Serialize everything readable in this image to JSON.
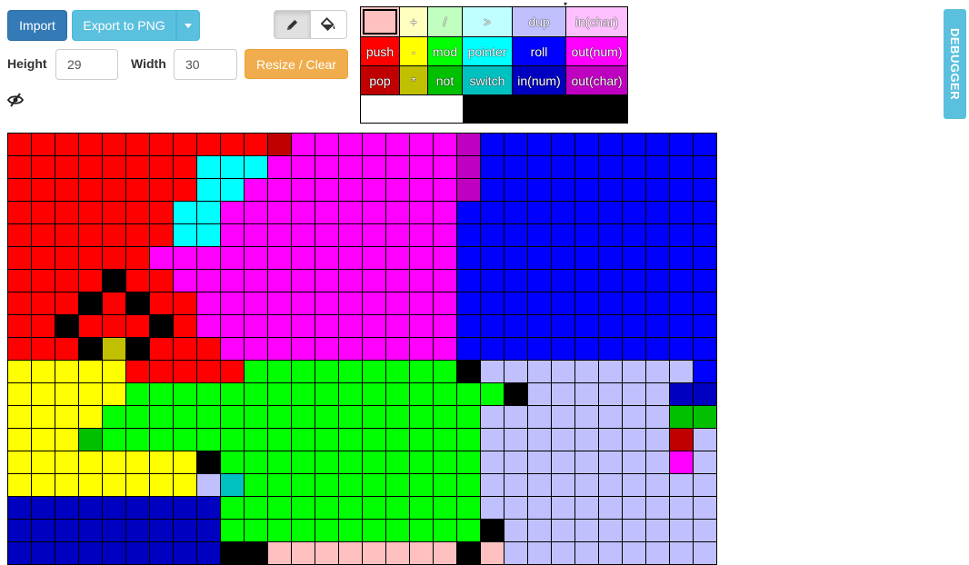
{
  "toolbar": {
    "import_label": "Import",
    "export_label": "Export to PNG",
    "caret_icon": "caret-down-icon",
    "pencil_icon": "pencil-icon",
    "bucket_icon": "paint-bucket-icon"
  },
  "size": {
    "height_label": "Height",
    "height_value": "29",
    "width_label": "Width",
    "width_value": "30",
    "resize_label": "Resize / Clear"
  },
  "visibility_icon": "eye-slash-icon",
  "debugger_label": "DEBUGGER",
  "palette": {
    "selected": "#ffc0c0",
    "rows": [
      [
        {
          "label": "",
          "color": "#ffc0c0"
        },
        {
          "label": "+",
          "color": "#ffffc0"
        },
        {
          "label": "/",
          "color": "#c0ffc0"
        },
        {
          "label": ">",
          "color": "#c0ffff"
        },
        {
          "label": "dup",
          "color": "#c0c0ff"
        },
        {
          "label": "in(char)",
          "color": "#ffc0ff"
        }
      ],
      [
        {
          "label": "push",
          "color": "#ff0000"
        },
        {
          "label": "-",
          "color": "#ffff00"
        },
        {
          "label": "mod",
          "color": "#00ff00"
        },
        {
          "label": "pointer",
          "color": "#00ffff"
        },
        {
          "label": "roll",
          "color": "#0000ff"
        },
        {
          "label": "out(num)",
          "color": "#ff00ff"
        }
      ],
      [
        {
          "label": "pop",
          "color": "#c00000"
        },
        {
          "label": "*",
          "color": "#c0c000"
        },
        {
          "label": "not",
          "color": "#00c000"
        },
        {
          "label": "switch",
          "color": "#00c0c0"
        },
        {
          "label": "in(num)",
          "color": "#0000c0"
        },
        {
          "label": "out(char)",
          "color": "#c000c0"
        }
      ]
    ],
    "white": "#ffffff",
    "black": "#000000"
  },
  "canvas": {
    "legend": {
      "R": "#ff0000",
      "r": "#c00000",
      "Y": "#ffff00",
      "y": "#c0c000",
      "G": "#00ff00",
      "g": "#00c000",
      "C": "#00ffff",
      "c": "#00c0c0",
      "B": "#0000ff",
      "b": "#0000c0",
      "M": "#ff00ff",
      "m": "#c000c0",
      "P": "#ffc0c0",
      "L": "#c0c0ff",
      "K": "#000000",
      "W": "#ffffff"
    },
    "rows": [
      "RRRRRRRRRRRrMMMMMMMmBBBBBBBBBB",
      "RRRRRRRRCCCMMMMMMMMmBBBBBBBBBB",
      "RRRRRRRRCCMMMMMMMMMmBBBBBBBBBB",
      "RRRRRRRCCMMMMMMMMMMBBBBBBBBBBB",
      "RRRRRRRCCMMMMMMMMMMBBBBBBBBBBB",
      "RRRRRRMMMMMMMMMMMMMBBBBBBBBBBB",
      "RRRRKRRMMMMMMMMMMMMBBBBBBBBBBB",
      "RRRKRKRRMMMMMMMMMMMBBBBBBBBBBB",
      "RRKRRRKRMMMMMMMMMMMBBBBBBBBBBB",
      "RRRKyKRRRMMMMMMMMMMBBBBBBBBBBB",
      "YYYYYRRRRRGGGGGGGGGKLLLLLLLLLB",
      "YYYYYGGGGGGGGGGGGGGGGKLLLLLLbb",
      "YYYYGGGGGGGGGGGGGGGGLLLLLLLLgg",
      "YYYgGGGGGGGGGGGGGGGGLLLLLLLLrL",
      "YYYYYYYYKGGGGGGGGGGGLLLLLLLLML",
      "YYYYYYYYLcGGGGGGGGGGLLLLLLLLLL",
      "bbbbbbbbbGGGGGGGGGGGLLLLLLLLLL",
      "bbbbbbbbbGGGGGGGGGGGKLLLLLLLLL",
      "bbbbbbbbbKKPPPPPPPPKPLLLLLLLLL"
    ]
  }
}
